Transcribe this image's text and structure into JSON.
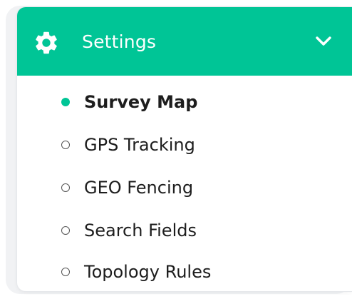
{
  "menu": {
    "title": "Settings",
    "header_icon": "gear-icon",
    "toggle_icon": "chevron-down-icon",
    "accent_color": "#00c596",
    "items": [
      {
        "label": "Survey Map",
        "active": true
      },
      {
        "label": "GPS Tracking",
        "active": false
      },
      {
        "label": "GEO Fencing",
        "active": false
      },
      {
        "label": "Search Fields",
        "active": false
      },
      {
        "label": "Topology Rules",
        "active": false
      }
    ]
  }
}
